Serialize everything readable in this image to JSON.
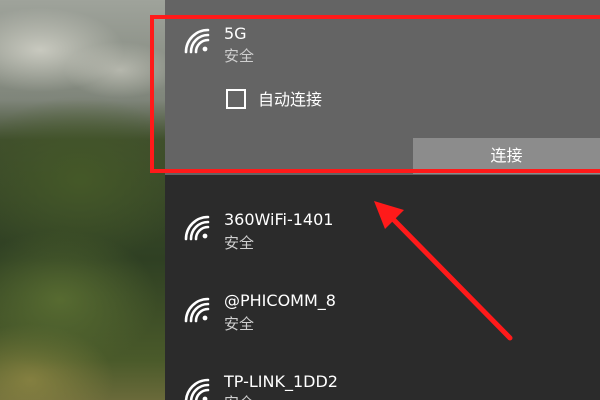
{
  "colors": {
    "annotation_red": "#ff1a1a",
    "panel_bg": "#2b2b2b",
    "selected_bg": "#646464",
    "button_bg": "#8c8c8c"
  },
  "selected_network": {
    "ssid": "5G",
    "security": "安全",
    "auto_connect_label": "自动连接",
    "auto_connect_checked": false,
    "connect_label": "连接",
    "icon": "wifi-icon"
  },
  "networks": [
    {
      "ssid": "360WiFi-1401",
      "security": "安全",
      "icon": "wifi-icon"
    },
    {
      "ssid": "@PHICOMM_8",
      "security": "安全",
      "icon": "wifi-icon"
    },
    {
      "ssid": "TP-LINK_1DD2",
      "security": "安全",
      "icon": "wifi-icon"
    }
  ]
}
